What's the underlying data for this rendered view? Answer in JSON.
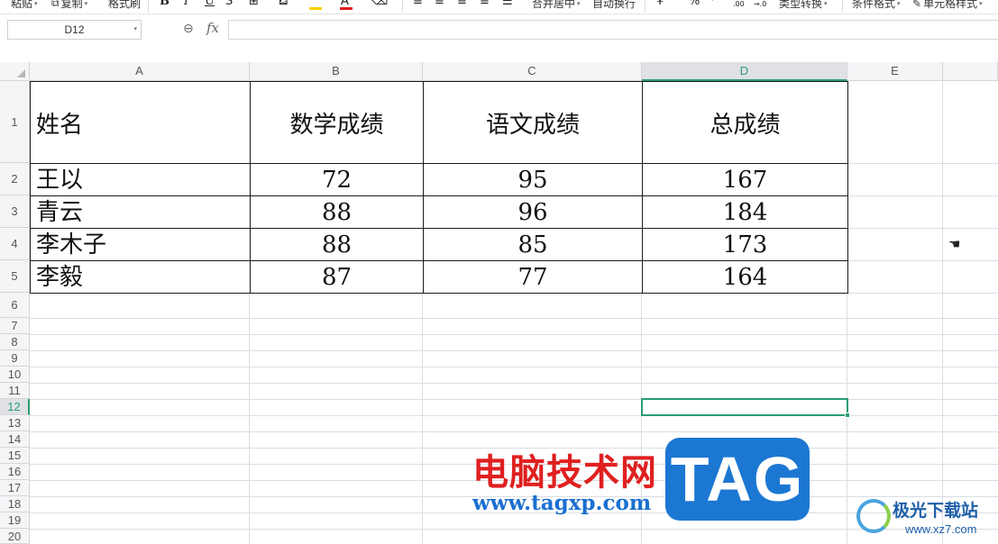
{
  "ribbon": {
    "paste": "粘贴",
    "copy": "复制",
    "format_painter": "格式刷",
    "bold": "B",
    "italic": "I",
    "underline": "U",
    "merge_center": "合并居中",
    "wrap_text": "自动换行",
    "percent": "%",
    "dec_inc": ".00",
    "dec_dec": "→.0",
    "type_convert": "类型转换",
    "cond_format": "条件格式",
    "cell_style": "单元格样式",
    "font_color": "#e02020",
    "fill_color": "#f5d200"
  },
  "formula_bar": {
    "name_box": "D12",
    "fx": "fx",
    "formula": ""
  },
  "columns": [
    "A",
    "B",
    "C",
    "D",
    "E"
  ],
  "active_column": "D",
  "rows": [
    "1",
    "2",
    "3",
    "4",
    "5",
    "6",
    "7",
    "8",
    "9",
    "10",
    "11",
    "12",
    "13",
    "14",
    "15",
    "16",
    "17",
    "18",
    "19",
    "20"
  ],
  "active_row": "12",
  "table": {
    "headers": [
      "姓名",
      "数学成绩",
      "语文成绩",
      "总成绩"
    ],
    "rows": [
      [
        "王以",
        "72",
        "95",
        "167"
      ],
      [
        "青云",
        "88",
        "96",
        "184"
      ],
      [
        "李木子",
        "88",
        "85",
        "173"
      ],
      [
        "李毅",
        "87",
        "77",
        "164"
      ]
    ]
  },
  "watermark": {
    "site_cn": "电脑技术网",
    "site_url": "www.tagxp.com",
    "tag": "TAG",
    "brand": "极光下载站",
    "brand_domain": "www.xz7.com"
  },
  "accent": "#2a9d70"
}
